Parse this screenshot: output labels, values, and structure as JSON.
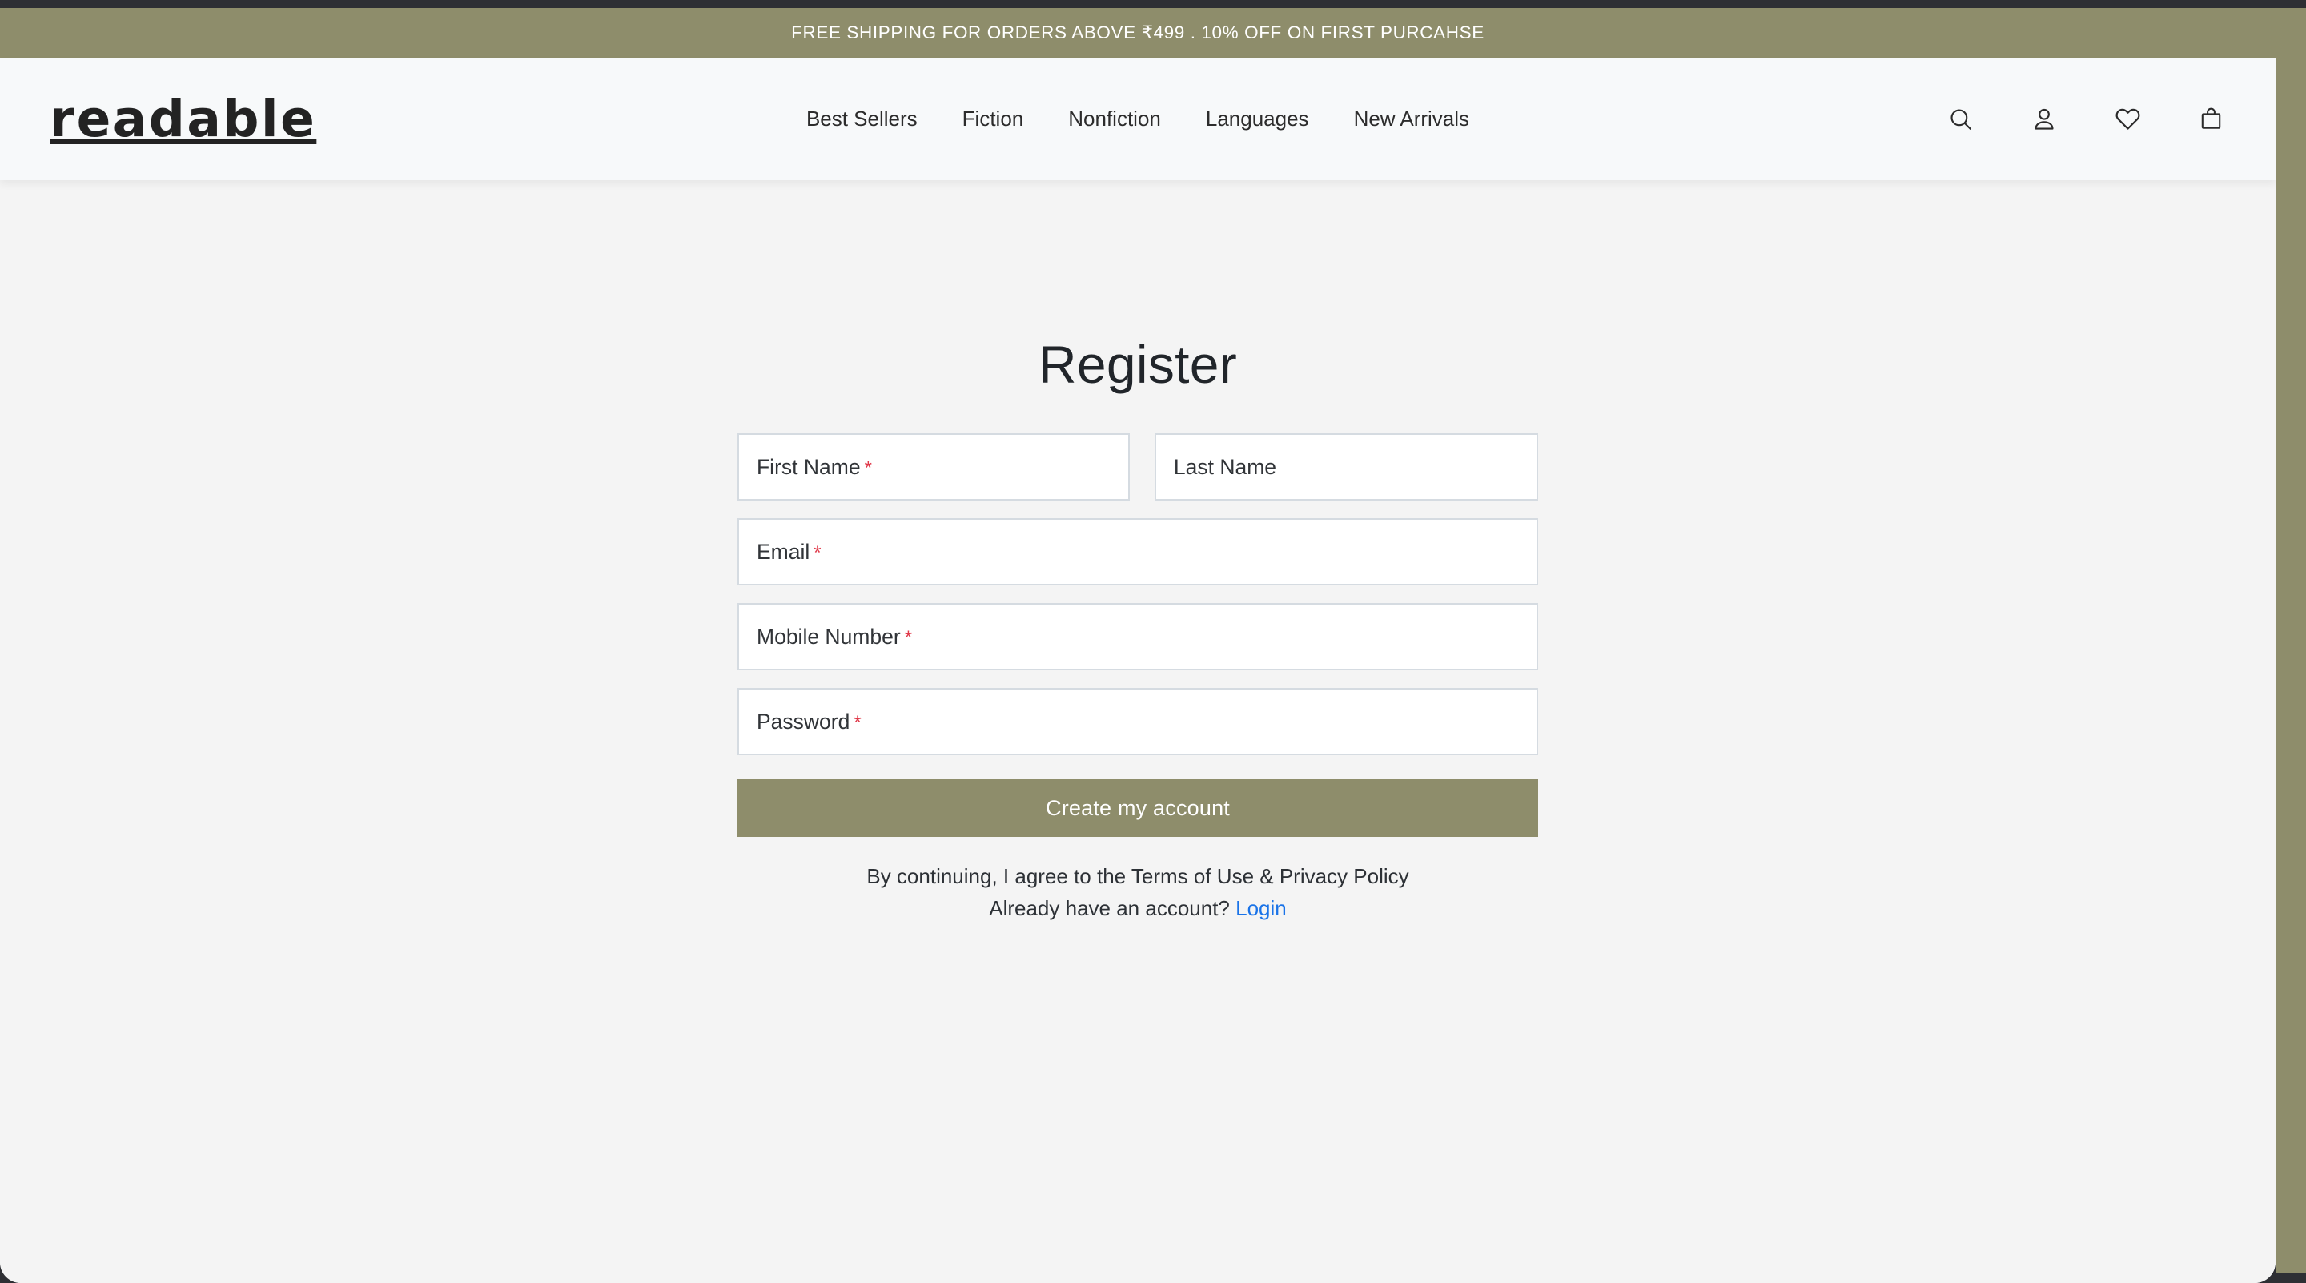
{
  "announcement": {
    "text": "FREE SHIPPING FOR ORDERS ABOVE ₹499 . 10% OFF ON FIRST PURCAHSE",
    "background_color": "#8e8d6b",
    "text_color": "#ffffff"
  },
  "header": {
    "logo": "readable",
    "nav": [
      {
        "label": "Best Sellers"
      },
      {
        "label": "Fiction"
      },
      {
        "label": "Nonfiction"
      },
      {
        "label": "Languages"
      },
      {
        "label": "New Arrivals"
      }
    ],
    "icons": [
      {
        "name": "search-icon",
        "label": "Search"
      },
      {
        "name": "account-icon",
        "label": "Account"
      },
      {
        "name": "wishlist-heart-icon",
        "label": "Wishlist"
      },
      {
        "name": "cart-bag-icon",
        "label": "Cart"
      }
    ]
  },
  "main": {
    "title": "Register",
    "form": {
      "fields": [
        {
          "name": "first-name",
          "label": "First Name",
          "required": true,
          "required_mark": "*",
          "value": "",
          "placeholder": "First Name"
        },
        {
          "name": "last-name",
          "label": "Last Name",
          "required": false,
          "required_mark": "",
          "value": "",
          "placeholder": "Last Name"
        },
        {
          "name": "email",
          "label": "Email",
          "required": true,
          "required_mark": "*",
          "value": "",
          "placeholder": "Email"
        },
        {
          "name": "mobile",
          "label": "Mobile Number",
          "required": true,
          "required_mark": "*",
          "value": "",
          "placeholder": "Mobile Number"
        },
        {
          "name": "password",
          "label": "Password",
          "required": true,
          "required_mark": "*",
          "value": "",
          "placeholder": "Password"
        }
      ],
      "submit_label": "Create my account",
      "submit_color": "#8e8d6b"
    },
    "legal": {
      "terms_line": "By continuing, I agree to the Terms of Use & Privacy Policy",
      "account_prompt": "Already have an account?",
      "login_label": "Login",
      "login_color": "#1a73e8"
    }
  },
  "theme": {
    "accent": "#8e8d6b",
    "page_background": "#f4f4f4",
    "header_background": "#f7f9fa",
    "field_border": "#d5dbe1",
    "required_color": "#e0394a"
  }
}
